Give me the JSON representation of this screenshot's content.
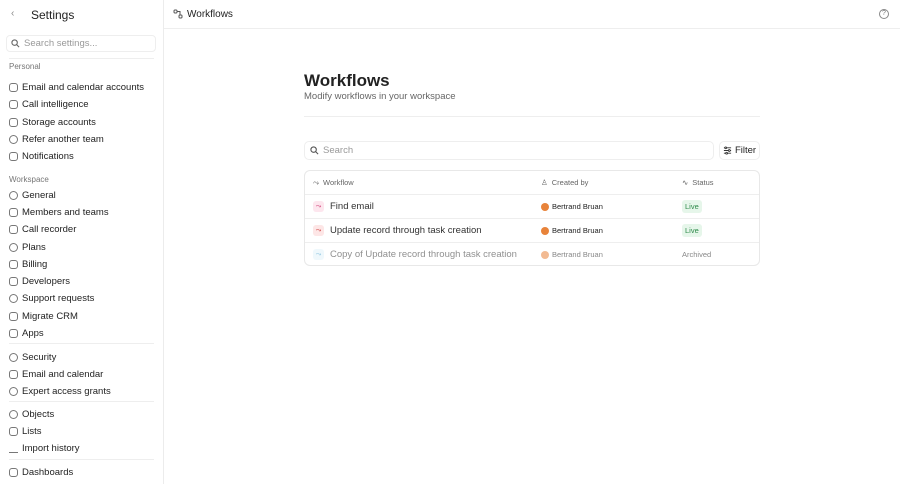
{
  "sidebar": {
    "title": "Settings",
    "search_placeholder": "Search settings...",
    "sections": {
      "personal": {
        "label": "Personal",
        "items": [
          "Email and calendar accounts",
          "Call intelligence",
          "Storage accounts",
          "Refer another team",
          "Notifications"
        ]
      },
      "workspace": {
        "label": "Workspace",
        "items": [
          "General",
          "Members and teams",
          "Call recorder",
          "Plans",
          "Billing",
          "Developers",
          "Support requests",
          "Migrate CRM",
          "Apps"
        ]
      },
      "security": {
        "items": [
          "Security",
          "Email and calendar",
          "Expert access grants"
        ]
      },
      "data": {
        "items": [
          "Objects",
          "Lists",
          "Import history"
        ]
      },
      "more": {
        "items": [
          "Dashboards"
        ]
      }
    }
  },
  "header": {
    "breadcrumb": "Workflows"
  },
  "main": {
    "title": "Workflows",
    "subtitle": "Modify workflows in your workspace",
    "search_placeholder": "Search",
    "filter_label": "Filter",
    "columns": [
      "Workflow",
      "Created by",
      "Status"
    ],
    "rows": [
      {
        "name": "Find email",
        "creator": "Bertrand Bruan",
        "status": "Live"
      },
      {
        "name": "Update record through task creation",
        "creator": "Bertrand Bruan",
        "status": "Live"
      },
      {
        "name": "Copy of Update record through task creation",
        "creator": "Bertrand Bruan",
        "status": "Archived"
      }
    ]
  }
}
